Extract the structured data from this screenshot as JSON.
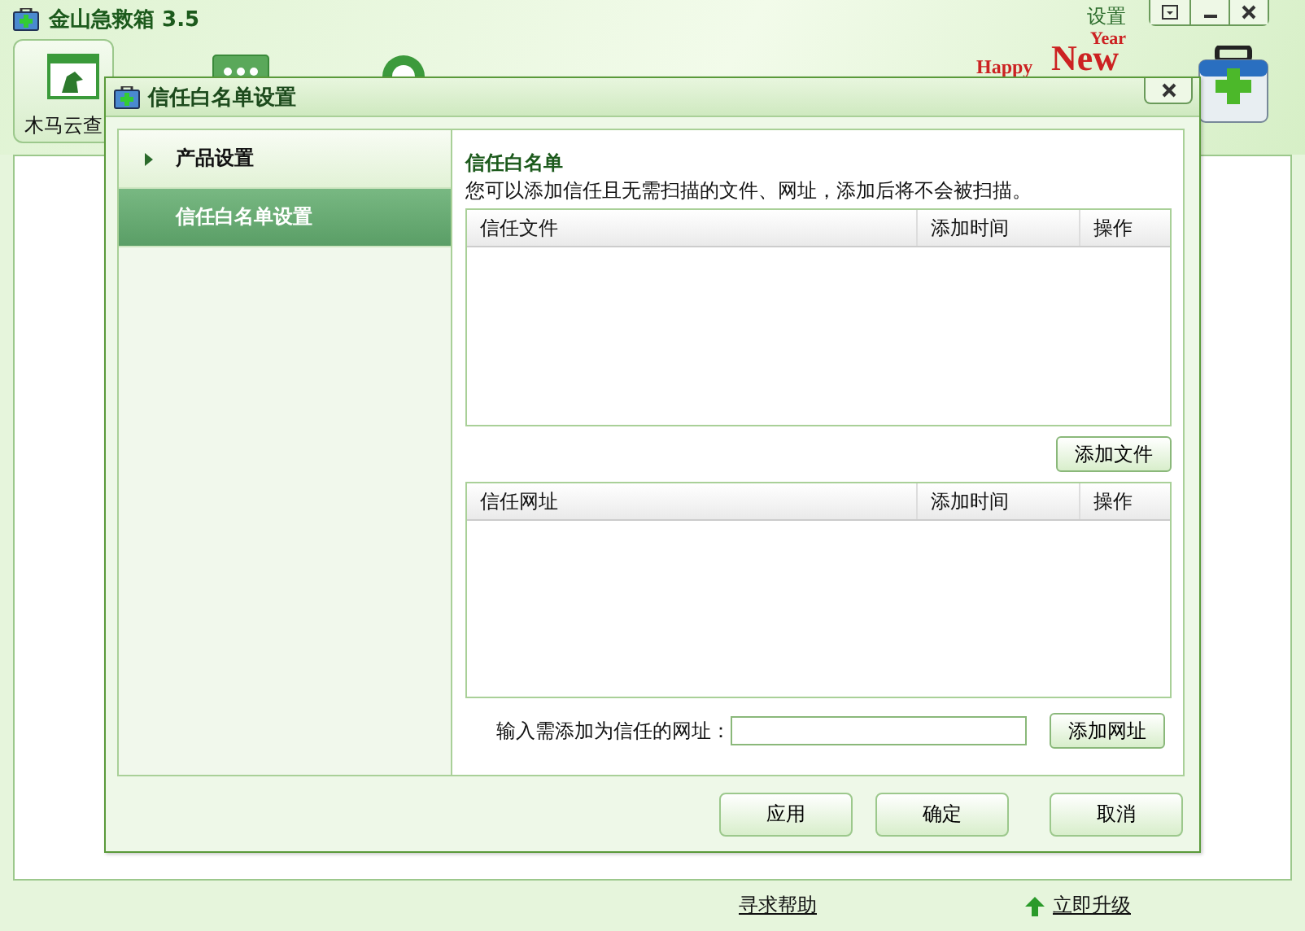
{
  "window": {
    "title": "金山急救箱 3.5",
    "settings_link": "设置"
  },
  "banner": {
    "happy": "Happy",
    "new": "New",
    "year": "Year"
  },
  "toolbar_tab": {
    "label": "木马云查"
  },
  "dialog": {
    "title": "信任白名单设置",
    "nav": [
      {
        "label": "产品设置",
        "selected": false,
        "has_arrow": true
      },
      {
        "label": "信任白名单设置",
        "selected": true,
        "has_arrow": false
      }
    ],
    "heading": "信任白名单",
    "description": "您可以添加信任且无需扫描的文件、网址，添加后将不会被扫描。",
    "tables": [
      {
        "columns": [
          "信任文件",
          "添加时间",
          "操作"
        ],
        "button": "添加文件"
      },
      {
        "columns": [
          "信任网址",
          "添加时间",
          "操作"
        ]
      }
    ],
    "url_input": {
      "label": "输入需添加为信任的网址：",
      "button": "添加网址"
    },
    "buttons": [
      "应用",
      "确定",
      "取消"
    ]
  },
  "footer": {
    "links": [
      "寻求帮助",
      "立即升级"
    ]
  }
}
